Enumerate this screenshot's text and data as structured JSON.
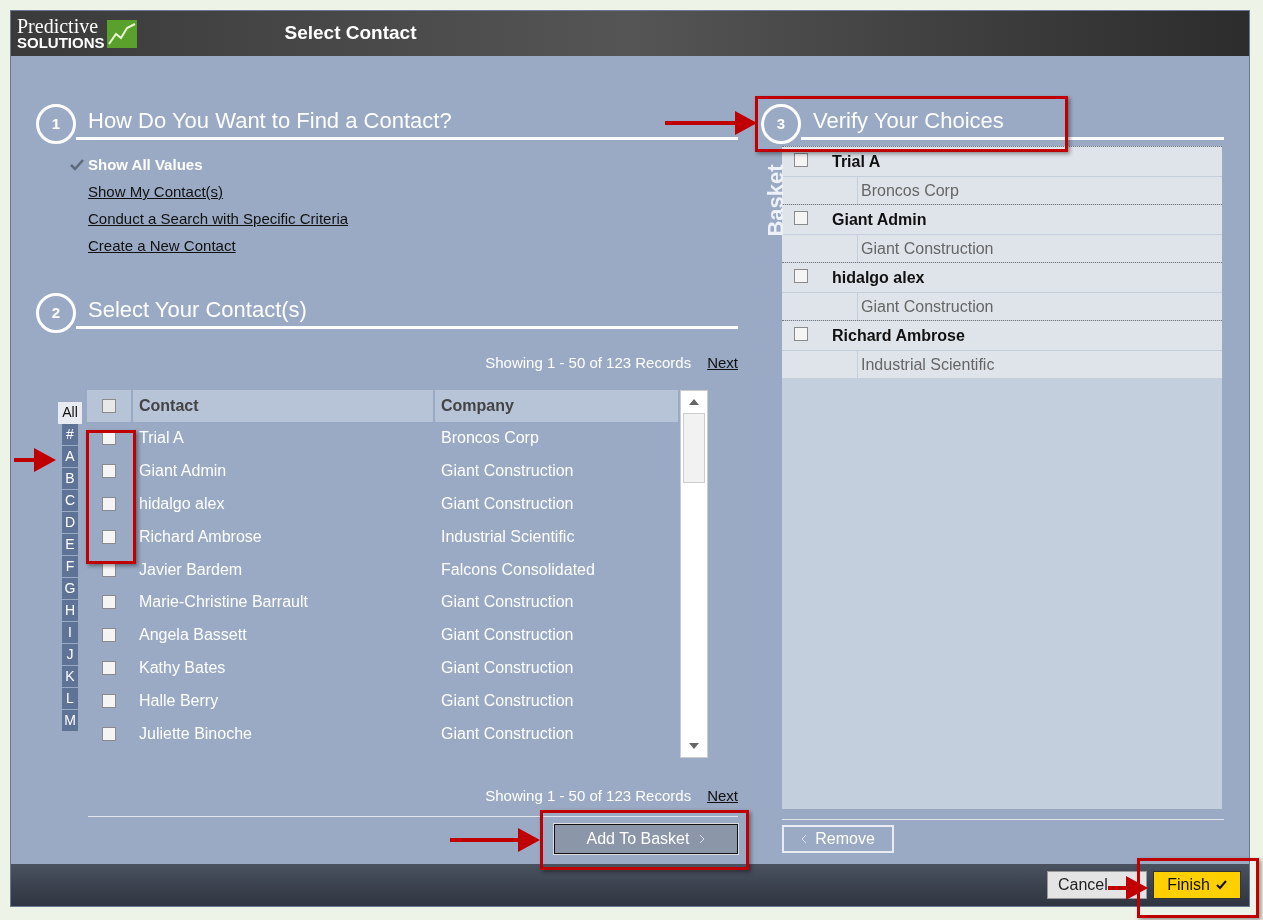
{
  "header": {
    "logo_top": "Predictive",
    "logo_bottom": "SOLUTIONS",
    "title": "Select Contact"
  },
  "step1": {
    "number": "1",
    "title": "How Do You Want to Find a Contact?",
    "options": [
      {
        "label": "Show All Values",
        "selected": true
      },
      {
        "label": "Show My Contact(s)",
        "selected": false
      },
      {
        "label": "Conduct a Search with Specific Criteria",
        "selected": false
      },
      {
        "label": "Create a New Contact",
        "selected": false
      }
    ]
  },
  "step2": {
    "number": "2",
    "title": "Select Your Contact(s)",
    "paging_top": {
      "text": "Showing 1 - 50 of 123 Records",
      "next": "Next"
    },
    "alphabet": [
      {
        "label": "All",
        "selected": true
      },
      {
        "label": "#",
        "selected": false
      },
      {
        "label": "A",
        "selected": false
      },
      {
        "label": "B",
        "selected": false
      },
      {
        "label": "C",
        "selected": false
      },
      {
        "label": "D",
        "selected": false
      },
      {
        "label": "E",
        "selected": false
      },
      {
        "label": "F",
        "selected": false
      },
      {
        "label": "G",
        "selected": false
      },
      {
        "label": "H",
        "selected": false
      },
      {
        "label": "I",
        "selected": false
      },
      {
        "label": "J",
        "selected": false
      },
      {
        "label": "K",
        "selected": false
      },
      {
        "label": "L",
        "selected": false
      },
      {
        "label": "M",
        "selected": false
      }
    ],
    "select_all": {
      "checked": false
    },
    "columns": [
      "Contact",
      "Company"
    ],
    "rows": [
      {
        "contact": "Trial A",
        "company": "Broncos Corp",
        "checked": false
      },
      {
        "contact": "Giant Admin",
        "company": "Giant Construction",
        "checked": false
      },
      {
        "contact": "hidalgo alex",
        "company": "Giant Construction",
        "checked": false
      },
      {
        "contact": "Richard Ambrose",
        "company": "Industrial Scientific",
        "checked": false
      },
      {
        "contact": "Javier Bardem",
        "company": "Falcons Consolidated",
        "checked": false
      },
      {
        "contact": "Marie-Christine Barrault",
        "company": "Giant Construction",
        "checked": false
      },
      {
        "contact": "Angela Bassett",
        "company": "Giant Construction",
        "checked": false
      },
      {
        "contact": "Kathy Bates",
        "company": "Giant Construction",
        "checked": false
      },
      {
        "contact": "Halle Berry",
        "company": "Giant Construction",
        "checked": false
      },
      {
        "contact": "Juliette Binoche",
        "company": "Giant Construction",
        "checked": false
      }
    ],
    "paging_bottom": {
      "text": "Showing 1 - 50 of 123 Records",
      "next": "Next"
    },
    "add_button": "Add To Basket"
  },
  "step3": {
    "number": "3",
    "title": "Verify Your Choices",
    "basket_label": "Basket",
    "items": [
      {
        "name": "Trial A",
        "company": "Broncos Corp",
        "checked": false
      },
      {
        "name": "Giant Admin",
        "company": "Giant Construction",
        "checked": false
      },
      {
        "name": "hidalgo alex",
        "company": "Giant Construction",
        "checked": false
      },
      {
        "name": "Richard Ambrose",
        "company": "Industrial Scientific",
        "checked": false
      }
    ],
    "remove_button": "Remove"
  },
  "footer": {
    "cancel": "Cancel",
    "finish": "Finish"
  }
}
